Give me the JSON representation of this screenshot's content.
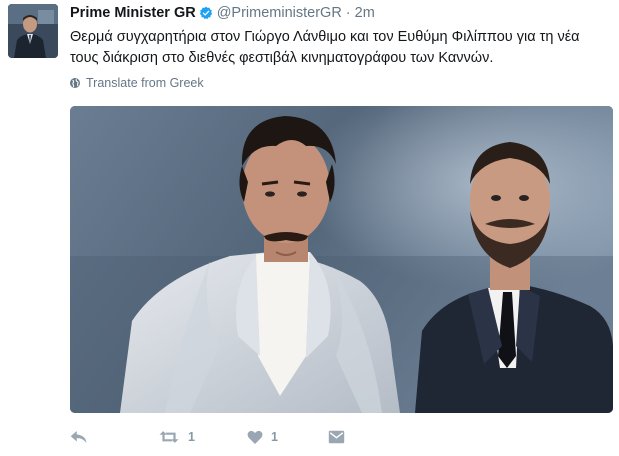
{
  "author": {
    "display_name": "Prime Minister GR",
    "handle": "@PrimeministerGR",
    "separator": "·",
    "timestamp": "2m",
    "verified": true,
    "avatar_icon": "profile-photo"
  },
  "tweet": {
    "text_line_1": "Θερμά συγχαρητήρια στον Γιώργο Λάνθιμο και τον Ευθύμη Φιλίππου για τη νέα",
    "text_line_2": "τους διάκριση στο διεθνές φεστιβάλ κινηματογράφου των Καννών."
  },
  "translate": {
    "label": "Translate from Greek",
    "icon": "globe-icon"
  },
  "media": {
    "type": "photo",
    "description_icon": "photo"
  },
  "actions": {
    "reply_icon": "reply-icon",
    "retweet_icon": "retweet-icon",
    "retweet_count": "1",
    "like_icon": "heart-icon",
    "like_count": "1",
    "dm_icon": "direct-message-icon"
  },
  "colors": {
    "verified_blue": "#1da1f2",
    "secondary_text": "#657786",
    "action_gray": "#9aa6b2"
  }
}
